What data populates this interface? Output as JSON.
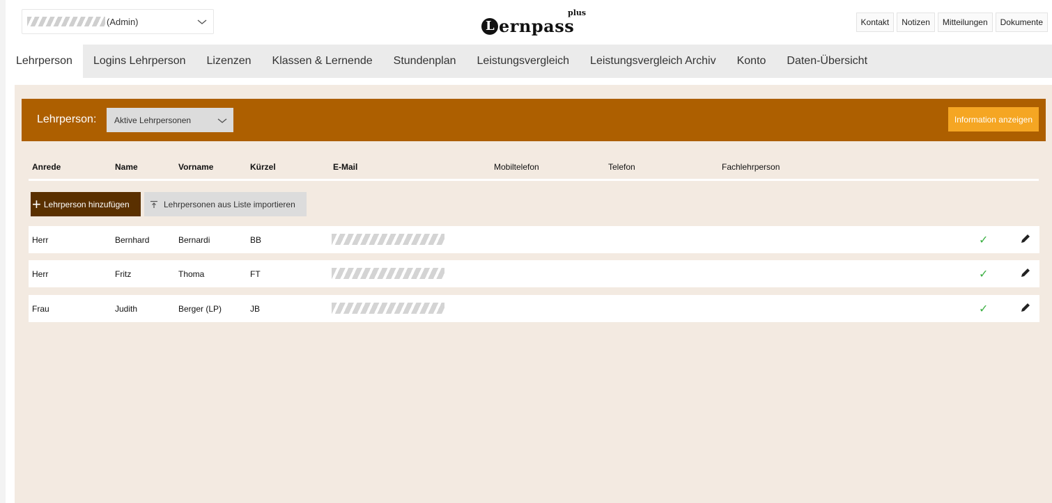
{
  "header": {
    "user_suffix": "(Admin)",
    "logo_text": "ernpass",
    "logo_initial": "L",
    "logo_plus": "plus",
    "links": [
      "Kontakt",
      "Notizen",
      "Mitteilungen",
      "Dokumente"
    ]
  },
  "nav": {
    "tabs": [
      {
        "label": "Lehrperson",
        "active": true
      },
      {
        "label": "Logins Lehrperson",
        "active": false
      },
      {
        "label": "Lizenzen",
        "active": false
      },
      {
        "label": "Klassen & Lernende",
        "active": false
      },
      {
        "label": "Stundenplan",
        "active": false
      },
      {
        "label": "Leistungsvergleich",
        "active": false
      },
      {
        "label": "Leistungsvergleich Archiv",
        "active": false
      },
      {
        "label": "Konto",
        "active": false
      },
      {
        "label": "Daten-Übersicht",
        "active": false
      }
    ]
  },
  "panel": {
    "label": "Lehrperson:",
    "filter_value": "Aktive Lehrpersonen",
    "info_button": "Information anzeigen"
  },
  "table": {
    "columns": {
      "anrede": "Anrede",
      "name": "Name",
      "vorname": "Vorname",
      "kuerzel": "Kürzel",
      "email": "E-Mail",
      "mobil": "Mobiltelefon",
      "telefon": "Telefon",
      "fach": "Fachlehrperson"
    },
    "add_button": "Lehrperson hinzufügen",
    "import_button": "Lehrpersonen aus Liste importieren",
    "rows": [
      {
        "anrede": "Herr",
        "name": "Bernhard",
        "vorname": "Bernardi",
        "kuerzel": "BB",
        "active_mark": "✓"
      },
      {
        "anrede": "Herr",
        "name": "Fritz",
        "vorname": "Thoma",
        "kuerzel": "FT",
        "active_mark": "✓"
      },
      {
        "anrede": "Frau",
        "name": "Judith",
        "vorname": "Berger (LP)",
        "kuerzel": "JB",
        "active_mark": "✓"
      }
    ]
  },
  "colors": {
    "accent_bar": "#ad5f00",
    "info_button": "#f5a623",
    "add_button": "#5a3000",
    "content_bg": "#f3eae1",
    "check": "#3cb043"
  },
  "icons": {
    "dropdown": "chevron-down-icon",
    "add": "plus-icon",
    "import": "upload-icon",
    "active": "check-icon",
    "edit": "pencil-icon"
  }
}
